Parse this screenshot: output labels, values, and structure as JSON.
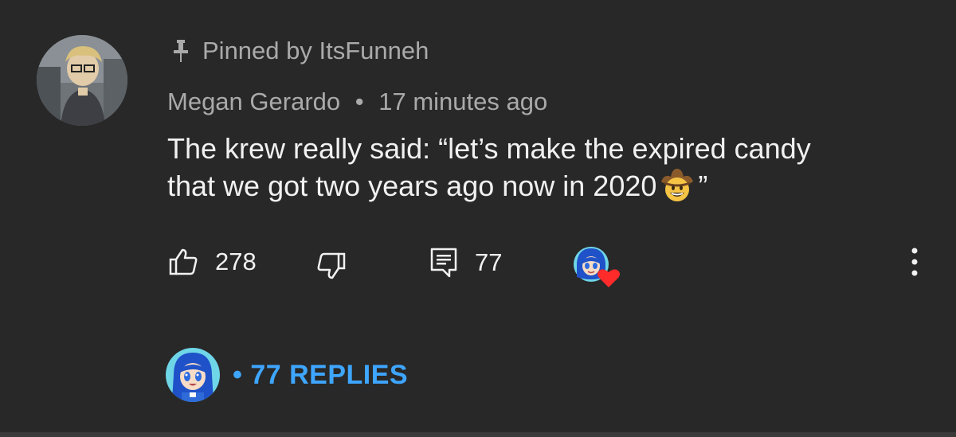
{
  "comment": {
    "pinned_label": "Pinned by ItsFunneh",
    "author": "Megan Gerardo",
    "separator": "•",
    "time": "17 minutes ago",
    "text_line1": "The krew really said: “let’s make the expired candy",
    "text_line2_a": "that we got two years ago now in 2020",
    "text_line2_b": "”"
  },
  "actions": {
    "likes": "278",
    "replies_count": "77"
  },
  "replies": {
    "link_text": "• 77 REPLIES"
  },
  "colors": {
    "background": "#282828",
    "secondary_text": "#aaaaaa",
    "primary_text": "#f1f1f1",
    "link": "#3ea6ff",
    "heart": "#ff2b2b"
  },
  "icons": {
    "pin": "pin-icon",
    "like": "thumbs-up-icon",
    "dislike": "thumbs-down-icon",
    "reply": "comment-icon",
    "creator_heart": "heart-icon",
    "more": "more-vertical-icon"
  }
}
